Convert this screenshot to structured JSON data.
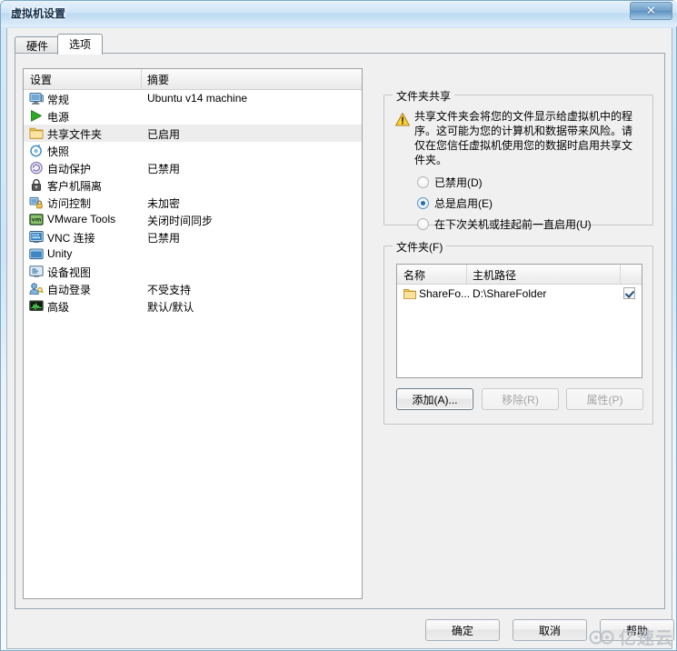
{
  "window": {
    "title": "虚拟机设置",
    "close_label": "✕"
  },
  "tabs": [
    {
      "label": "硬件",
      "active": false
    },
    {
      "label": "选项",
      "active": true
    }
  ],
  "settings_list": {
    "columns": [
      "设置",
      "摘要"
    ],
    "rows": [
      {
        "icon": "monitor-icon",
        "name": "常规",
        "summary": "Ubuntu v14 machine",
        "selected": false
      },
      {
        "icon": "power-play-icon",
        "name": "电源",
        "summary": "",
        "selected": false
      },
      {
        "icon": "folder-icon",
        "name": "共享文件夹",
        "summary": "已启用",
        "selected": true
      },
      {
        "icon": "snapshot-icon",
        "name": "快照",
        "summary": "",
        "selected": false
      },
      {
        "icon": "autoprotect-icon",
        "name": "自动保护",
        "summary": "已禁用",
        "selected": false
      },
      {
        "icon": "lock-icon",
        "name": "客户机隔离",
        "summary": "",
        "selected": false
      },
      {
        "icon": "access-lock-icon",
        "name": "访问控制",
        "summary": "未加密",
        "selected": false
      },
      {
        "icon": "vmware-tools-icon",
        "name": "VMware Tools",
        "summary": "关闭时间同步",
        "selected": false
      },
      {
        "icon": "vnc-icon",
        "name": "VNC 连接",
        "summary": "已禁用",
        "selected": false
      },
      {
        "icon": "unity-icon",
        "name": "Unity",
        "summary": "",
        "selected": false
      },
      {
        "icon": "device-view-icon",
        "name": "设备视图",
        "summary": "",
        "selected": false
      },
      {
        "icon": "autologon-icon",
        "name": "自动登录",
        "summary": "不受支持",
        "selected": false
      },
      {
        "icon": "advanced-icon",
        "name": "高级",
        "summary": "默认/默认",
        "selected": false
      }
    ]
  },
  "sharing_group": {
    "title": "文件夹共享",
    "warning_text": "共享文件夹会将您的文件显示给虚拟机中的程序。这可能为您的计算机和数据带来风险。请仅在您信任虚拟机使用您的数据时启用共享文件夹。",
    "options": [
      {
        "label": "已禁用(D)",
        "checked": false
      },
      {
        "label": "总是启用(E)",
        "checked": true
      },
      {
        "label": "在下次关机或挂起前一直启用(U)",
        "checked": false
      }
    ]
  },
  "folders_group": {
    "title": "文件夹(F)",
    "columns": [
      "名称",
      "主机路径"
    ],
    "rows": [
      {
        "icon": "folder-icon",
        "name": "ShareFo...",
        "host_path": "D:\\ShareFolder",
        "enabled": true
      }
    ],
    "buttons": [
      {
        "label": "添加(A)...",
        "enabled": true
      },
      {
        "label": "移除(R)",
        "enabled": false
      },
      {
        "label": "属性(P)",
        "enabled": false
      }
    ]
  },
  "footer": {
    "ok_label": "确定",
    "cancel_label": "取消",
    "help_label": "帮助"
  },
  "watermark": {
    "text": "亿速云"
  },
  "colors": {
    "accent": "#2a6ea8",
    "titlebar": "#cfe5f7",
    "selection": "#ededed",
    "folder_yellow": "#f0c453",
    "warning_yellow": "#f7d33c"
  }
}
